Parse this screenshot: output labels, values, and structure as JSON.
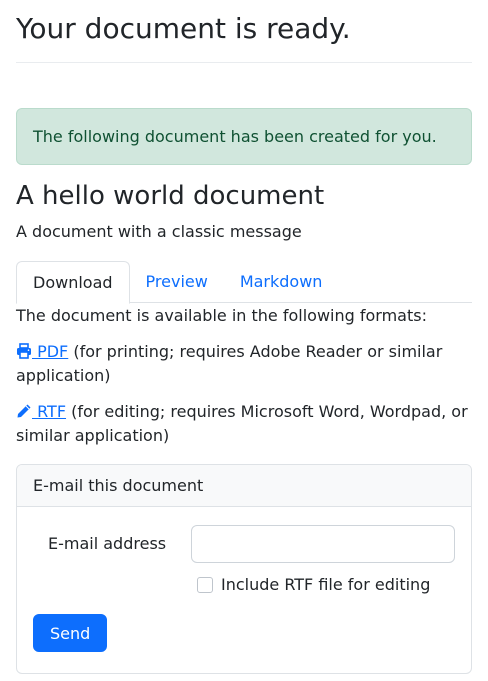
{
  "page": {
    "title": "Your document is ready."
  },
  "alert": {
    "message": "The following document has been created for you.",
    "color": "#d1e7dd"
  },
  "document": {
    "title": "A hello world document",
    "description": "A document with a classic message"
  },
  "tabs": [
    {
      "label": "Download",
      "active": true
    },
    {
      "label": "Preview",
      "active": false
    },
    {
      "label": "Markdown",
      "active": false
    }
  ],
  "download": {
    "intro": "The document is available in the following formats:",
    "formats": [
      {
        "icon": "printer-icon",
        "link_label": " PDF",
        "description": " (for printing; requires Adobe Reader or similar application)"
      },
      {
        "icon": "pencil-icon",
        "link_label": " RTF",
        "description": " (for editing; requires Microsoft Word, Wordpad, or similar application)"
      }
    ]
  },
  "email_card": {
    "header": "E-mail this document",
    "email_label": "E-mail address",
    "email_value": "",
    "email_placeholder": "",
    "checkbox_label": "Include RTF file for editing",
    "checkbox_checked": false,
    "send_label": "Send",
    "accent_color": "#0d6efd"
  }
}
